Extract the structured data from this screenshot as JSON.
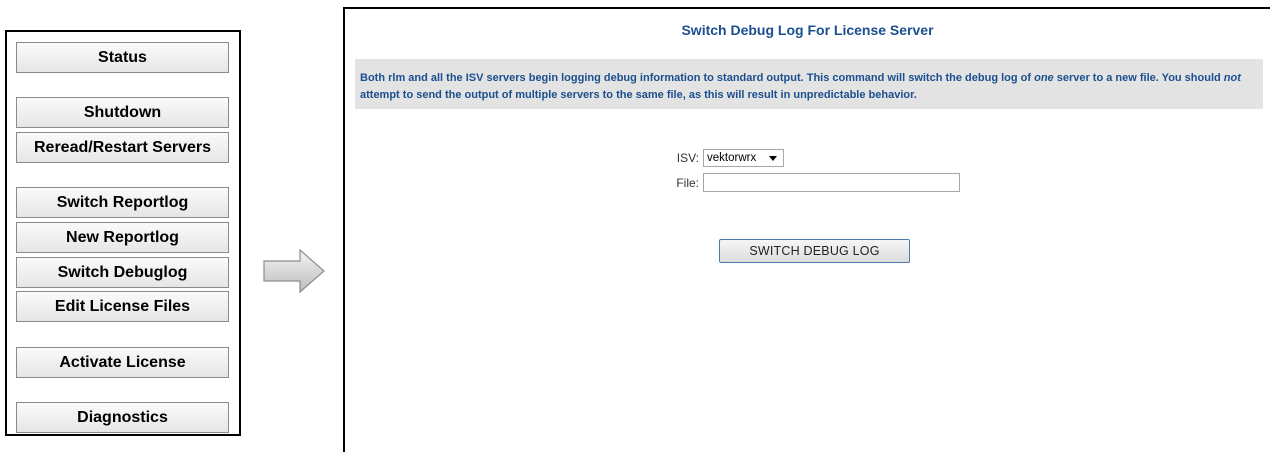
{
  "nav": {
    "items": [
      {
        "label": "Status"
      },
      {
        "label": "Shutdown"
      },
      {
        "label": "Reread/Restart Servers"
      },
      {
        "label": "Switch Reportlog"
      },
      {
        "label": "New Reportlog"
      },
      {
        "label": "Switch Debuglog"
      },
      {
        "label": "Edit License Files"
      },
      {
        "label": "Activate License"
      },
      {
        "label": "Diagnostics"
      }
    ]
  },
  "arrow": {
    "icon": "right-arrow-icon"
  },
  "main": {
    "title": "Switch Debug Log For License Server",
    "info": {
      "part1": "Both rlm and all the ISV servers begin logging debug information to standard output. This command will switch the debug log of ",
      "em1": "one",
      "part2": " server to a new file. You should ",
      "em2": "not",
      "part3": " attempt to send the output of multiple servers to the same file, as this will result in unpredictable behavior."
    },
    "form": {
      "isv_label": "ISV:",
      "isv_value": "vektorwrx",
      "file_label": "File:",
      "file_value": "",
      "submit_label": "SWITCH DEBUG LOG"
    }
  },
  "colors": {
    "title_text": "#1b4f8f",
    "info_bg": "#e3e3e3",
    "button_border": "#4a7bb0"
  }
}
